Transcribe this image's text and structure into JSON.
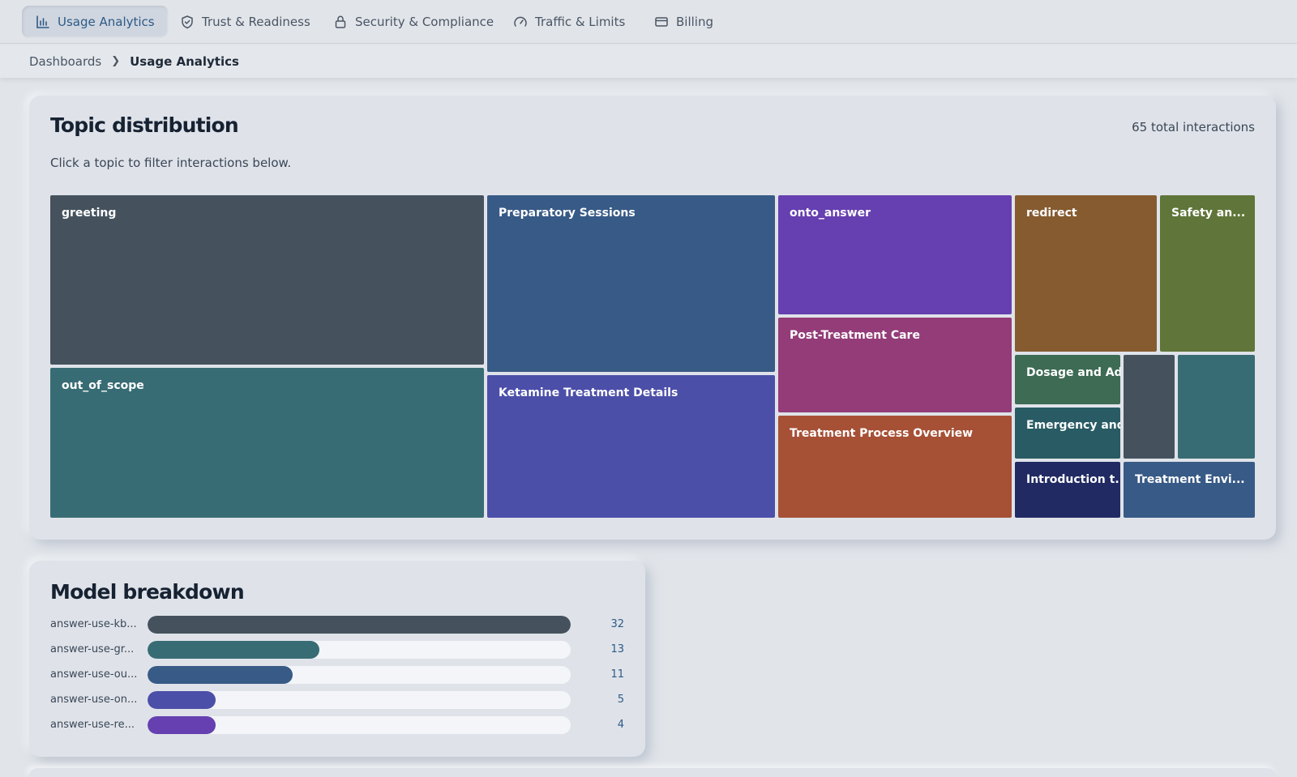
{
  "nav": {
    "tabs": [
      {
        "label": "Usage Analytics",
        "icon": "bar-chart-icon",
        "active": true
      },
      {
        "label": "Trust & Readiness",
        "icon": "shield-check-icon",
        "active": false
      },
      {
        "label": "Security & Compliance",
        "icon": "lock-icon",
        "active": false
      },
      {
        "label": "Traffic & Limits",
        "icon": "gauge-icon",
        "active": false
      },
      {
        "label": "Billing",
        "icon": "credit-card-icon",
        "active": false
      }
    ]
  },
  "breadcrumb": {
    "parent": "Dashboards",
    "current": "Usage Analytics"
  },
  "topics": {
    "title": "Topic distribution",
    "subtitle": "Click a topic to filter interactions below.",
    "total": "65 total interactions",
    "tiles": [
      {
        "label": "greeting",
        "color": "#45525e"
      },
      {
        "label": "out_of_scope",
        "color": "#386c74"
      },
      {
        "label": "Preparatory Sessions",
        "color": "#385a86"
      },
      {
        "label": "Ketamine Treatment Details",
        "color": "#4c4fa8"
      },
      {
        "label": "onto_answer",
        "color": "#6640b0"
      },
      {
        "label": "Post-Treatment Care",
        "color": "#933c78"
      },
      {
        "label": "Treatment Process Overview",
        "color": "#a65036"
      },
      {
        "label": "redirect",
        "color": "#865b30"
      },
      {
        "label": "Safety an...",
        "color": "#607539"
      },
      {
        "label": "Dosage and Adm...",
        "color": "#3d6b54"
      },
      {
        "label": "",
        "color": "#45525e"
      },
      {
        "label": "",
        "color": "#386c74"
      },
      {
        "label": "Emergency and ...",
        "color": "#285b63"
      },
      {
        "label": "Introduction t...",
        "color": "#212a63"
      },
      {
        "label": "Treatment Envi...",
        "color": "#385a86"
      }
    ]
  },
  "models": {
    "title": "Model breakdown",
    "max": 32,
    "rows": [
      {
        "label": "answer-use-kb...",
        "value": 32,
        "display": "32",
        "color": "#45525e"
      },
      {
        "label": "answer-use-gr...",
        "value": 13,
        "display": "13",
        "color": "#386c74"
      },
      {
        "label": "answer-use-ou...",
        "value": 11,
        "display": "11",
        "color": "#385a86"
      },
      {
        "label": "answer-use-on...",
        "value": 5,
        "display": "5",
        "color": "#4c4fa8"
      },
      {
        "label": "answer-use-re...",
        "value": 4,
        "display": "4",
        "color": "#6640b0"
      }
    ]
  }
}
